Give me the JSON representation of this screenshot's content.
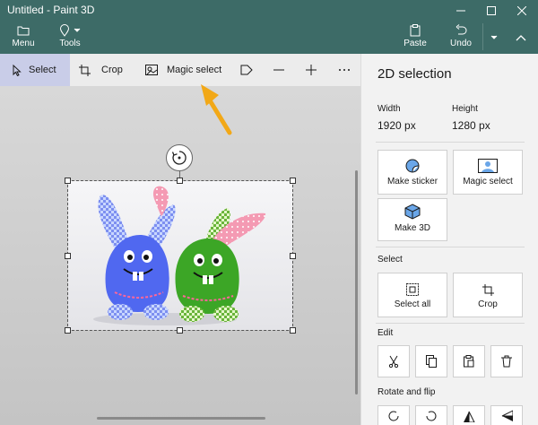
{
  "window": {
    "title": "Untitled - Paint 3D"
  },
  "ribbon": {
    "menu_label": "Menu",
    "tools_label": "Tools",
    "paste_label": "Paste",
    "undo_label": "Undo"
  },
  "toolbar": {
    "select_label": "Select",
    "crop_label": "Crop",
    "magic_select_label": "Magic select"
  },
  "panel": {
    "title": "2D selection",
    "width_label": "Width",
    "width_value": "1920 px",
    "height_label": "Height",
    "height_value": "1280 px",
    "make_sticker_label": "Make sticker",
    "magic_select_label": "Magic select",
    "make_3d_label": "Make 3D",
    "select_section": "Select",
    "select_all_label": "Select all",
    "crop_label": "Crop",
    "edit_section": "Edit",
    "rotate_section": "Rotate and flip"
  },
  "colors": {
    "titlebar": "#3d6b67",
    "active_tool": "#c9cde8",
    "arrow": "#f2a817"
  }
}
